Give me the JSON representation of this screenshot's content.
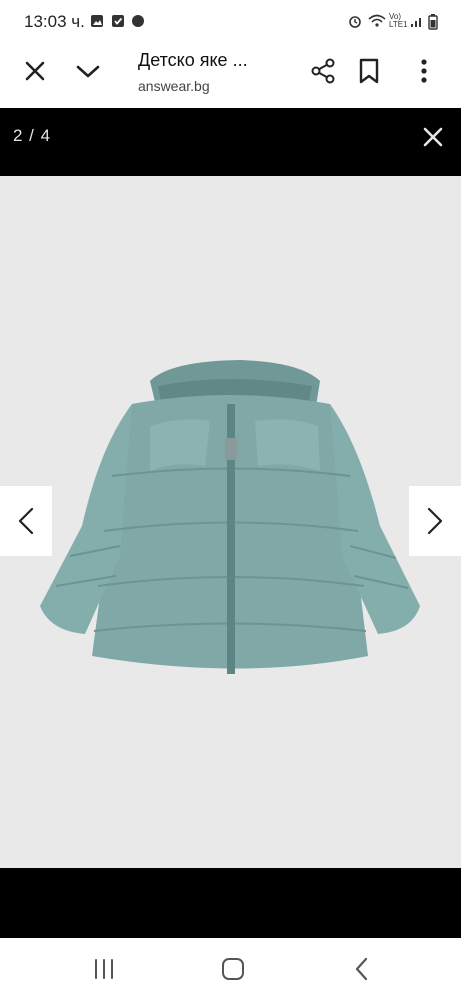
{
  "status_bar": {
    "time": "13:03 ч.",
    "network_label": "Vo) LTE1"
  },
  "browser": {
    "title": "Детско яке ...",
    "url": "answear.bg"
  },
  "gallery": {
    "counter": "2 / 4"
  },
  "icons": [
    "close-icon",
    "chevron-down-icon",
    "share-icon",
    "bookmark-icon",
    "more-vert-icon",
    "close-viewer-icon",
    "chevron-left-icon",
    "chevron-right-icon",
    "recent-apps-icon",
    "home-icon",
    "back-icon"
  ],
  "colors": {
    "jacket": "#7fa8a6",
    "viewer_bg": "#e9e9e9",
    "bars": "#000000"
  }
}
